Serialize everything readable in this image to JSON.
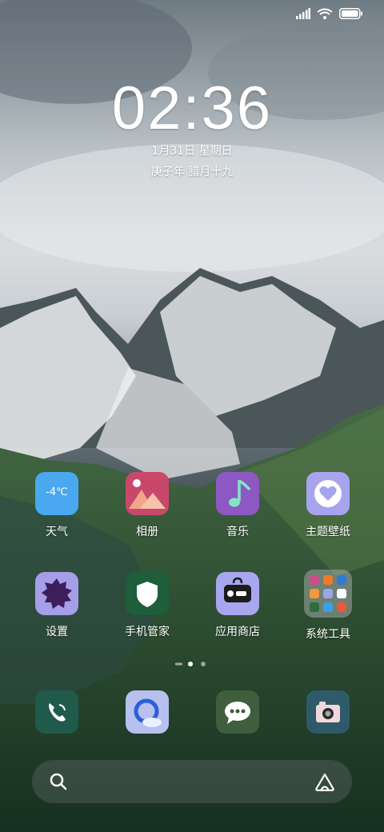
{
  "status_bar": {
    "icons": [
      "signal-icon",
      "wifi-icon",
      "battery-icon"
    ]
  },
  "lockclock": {
    "time": "02:36",
    "date": "1月31日 星期日",
    "lunar": "庚子年 腊月十九"
  },
  "apps": [
    {
      "label": "天气",
      "icon": "weather-icon",
      "badge": "-4℃",
      "color": "#4aa8f0"
    },
    {
      "label": "相册",
      "icon": "gallery-icon",
      "color": "#c9486a"
    },
    {
      "label": "音乐",
      "icon": "music-icon",
      "color": "#8e58c4"
    },
    {
      "label": "主题壁纸",
      "icon": "theme-icon",
      "color": "#a7a4ee"
    },
    {
      "label": "设置",
      "icon": "settings-icon",
      "color": "#a59ee8"
    },
    {
      "label": "手机管家",
      "icon": "security-icon",
      "color": "#1e5e3a"
    },
    {
      "label": "应用商店",
      "icon": "store-icon",
      "color": "#a9a6f0"
    },
    {
      "label": "系统工具",
      "icon": "folder-icon",
      "color": "#7f8a88"
    }
  ],
  "page_indicator": {
    "pages": 2,
    "current": 1
  },
  "dock": [
    {
      "icon": "phone-icon",
      "color": "#1f5a4a"
    },
    {
      "icon": "browser-icon",
      "color": "#b7c0ee"
    },
    {
      "icon": "messages-icon",
      "color": "#3e5e3e"
    },
    {
      "icon": "camera-icon",
      "color": "#2f5a6a"
    }
  ],
  "search": {
    "left_icon": "search-icon",
    "right_icon": "assistant-icon"
  }
}
